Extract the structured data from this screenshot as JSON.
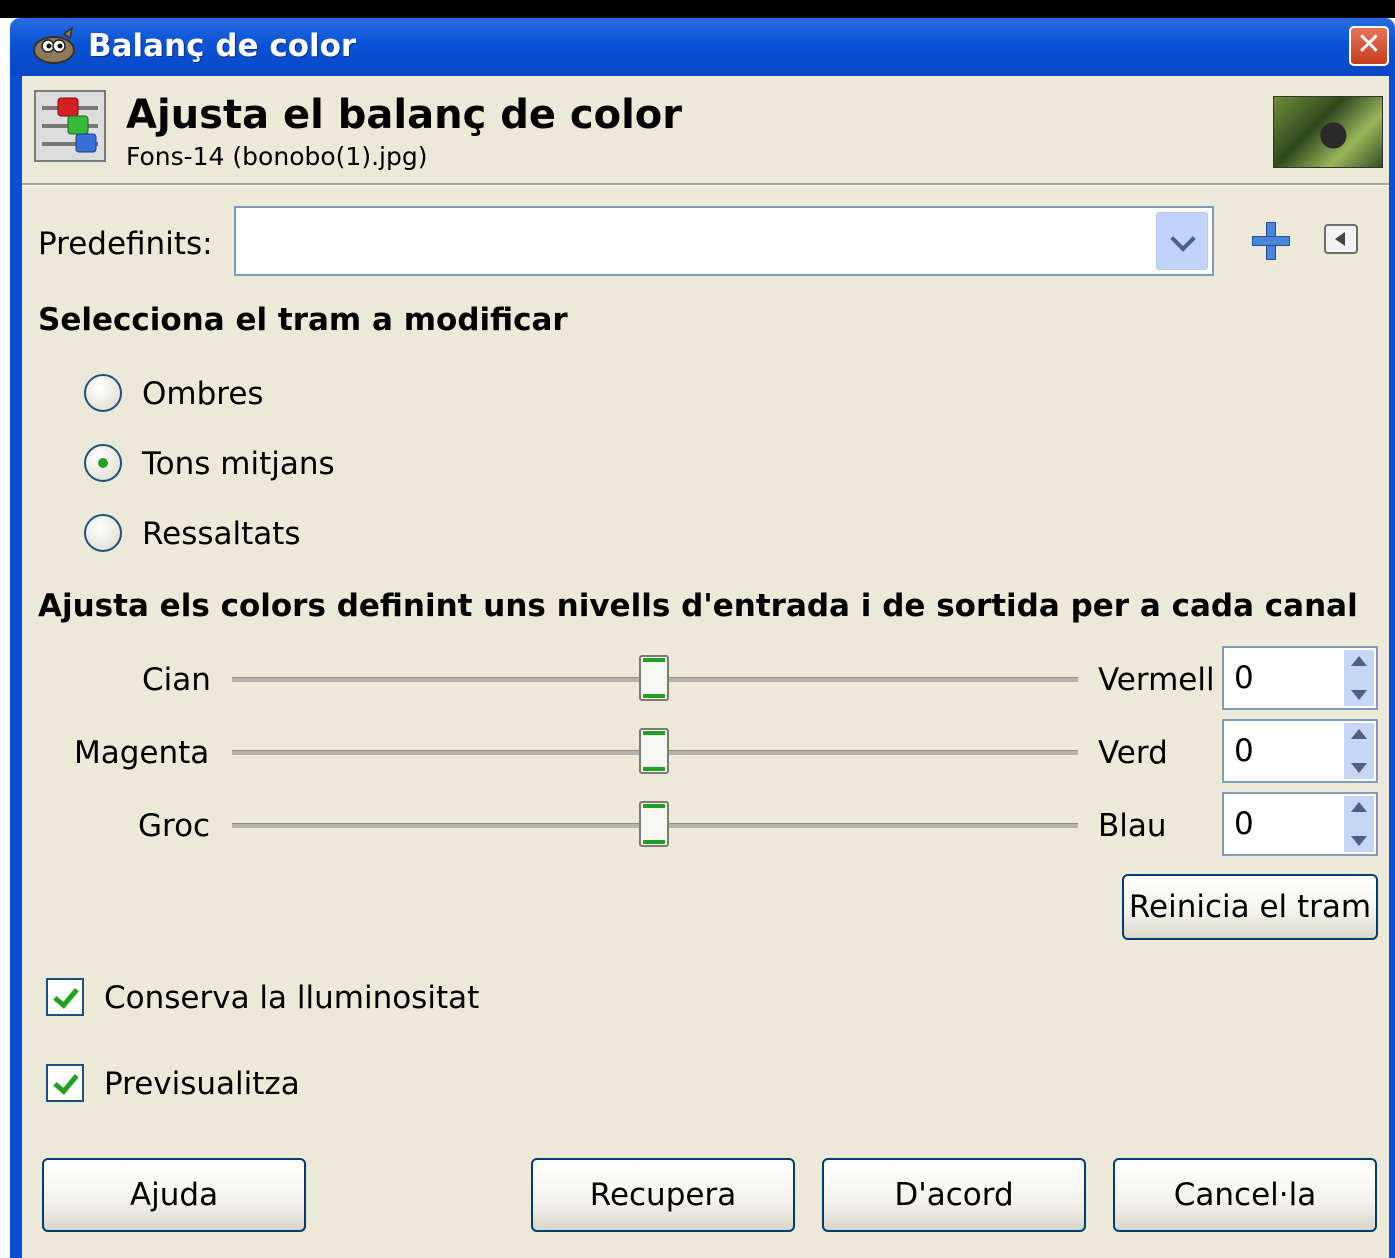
{
  "window": {
    "title": "Balanç de color"
  },
  "header": {
    "title": "Ajusta el balanç de color",
    "subtitle": "Fons-14 (bonobo(1).jpg)"
  },
  "presets": {
    "label": "Predefinits:",
    "value": ""
  },
  "range_section": {
    "heading": "Selecciona el tram a modificar",
    "options": [
      {
        "label": "Ombres",
        "checked": false
      },
      {
        "label": "Tons mitjans",
        "checked": true
      },
      {
        "label": "Ressaltats",
        "checked": false
      }
    ]
  },
  "levels_section": {
    "heading": "Ajusta els colors definint uns nivells d'entrada i de sortida per a cada canal",
    "sliders": [
      {
        "left_label": "Cian",
        "right_label": "Vermell",
        "value": "0"
      },
      {
        "left_label": "Magenta",
        "right_label": "Verd",
        "value": "0"
      },
      {
        "left_label": "Groc",
        "right_label": "Blau",
        "value": "0"
      }
    ],
    "reset_label": "Reinicia el tram"
  },
  "options": {
    "preserve_luminosity": {
      "label": "Conserva la lluminositat",
      "checked": true
    },
    "preview": {
      "label": "Previsualitza",
      "checked": true
    }
  },
  "buttons": {
    "help": "Ajuda",
    "reset": "Recupera",
    "ok": "D'acord",
    "cancel": "Cancel·la"
  },
  "colors": {
    "titlebar": "#0a52d8",
    "dialog_bg": "#ece9d8",
    "accent_green": "#21a121"
  }
}
